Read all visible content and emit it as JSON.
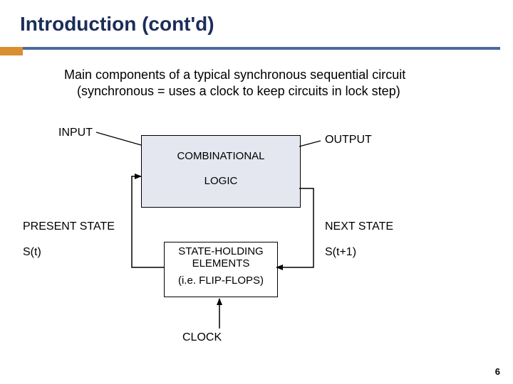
{
  "title": "Introduction (cont'd)",
  "desc": {
    "line1": "Main components of a typical synchronous sequential circuit",
    "line2": "(synchronous = uses a clock to keep circuits in lock step)"
  },
  "labels": {
    "input": "INPUT",
    "output": "OUTPUT",
    "present_state": "PRESENT STATE",
    "next_state": "NEXT STATE",
    "st": "S(t)",
    "st1": "S(t+1)",
    "clock": "CLOCK"
  },
  "boxes": {
    "comb_top": "COMBINATIONAL",
    "comb_bot": "LOGIC",
    "sh_top": "STATE-HOLDING ELEMENTS",
    "sh_bot": "(i.e. FLIP-FLOPS)"
  },
  "pagenum": "6"
}
